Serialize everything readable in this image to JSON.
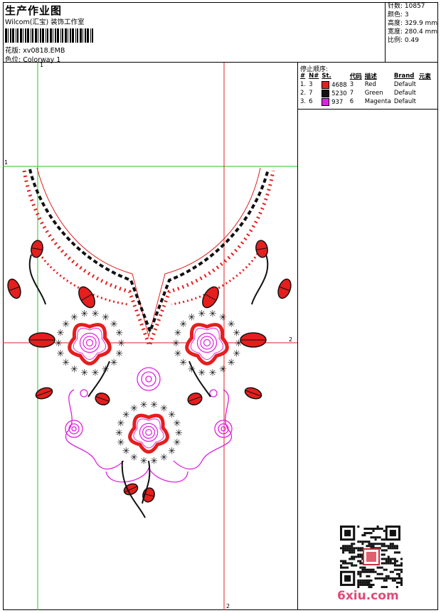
{
  "header": {
    "title": "生产作业图",
    "company": "Wilcom(汇宝) 装饰工作室",
    "design_label": "花版:",
    "design_value": "xv0818.EMB",
    "colorway_label": "色位:",
    "colorway_value": "Colorway 1"
  },
  "stats": [
    {
      "label": "针数:",
      "value": "10857"
    },
    {
      "label": "颜色:",
      "value": "3"
    },
    {
      "label": "高度:",
      "value": "329.9 mm"
    },
    {
      "label": "宽度:",
      "value": "280.4 mm"
    },
    {
      "label": "比例:",
      "value": "0.49"
    }
  ],
  "stop_sequence": {
    "title": "停止顺序:",
    "columns": [
      "#",
      "N#",
      "St.",
      "代码",
      "描述",
      "Brand",
      "元素"
    ],
    "rows": [
      {
        "idx": "1.",
        "n": "3",
        "color": "#e51e1e",
        "st": "4688",
        "code": "3",
        "desc": "Red",
        "brand": "Default"
      },
      {
        "idx": "2.",
        "n": "7",
        "color": "#111111",
        "st": "5230",
        "code": "7",
        "desc": "Green",
        "brand": "Default"
      },
      {
        "idx": "3.",
        "n": "6",
        "color": "#e020e0",
        "st": "937",
        "code": "6",
        "desc": "Magenta",
        "brand": "Default"
      }
    ]
  },
  "guides": {
    "v1": "1",
    "h1": "1",
    "h2": "2",
    "v2": "2"
  },
  "watermark": "6xiu.com",
  "colors": {
    "red": "#e51e1e",
    "black": "#111111",
    "magenta": "#e020e0",
    "guide_green": "#22c422",
    "guide_red": "#e02020"
  }
}
